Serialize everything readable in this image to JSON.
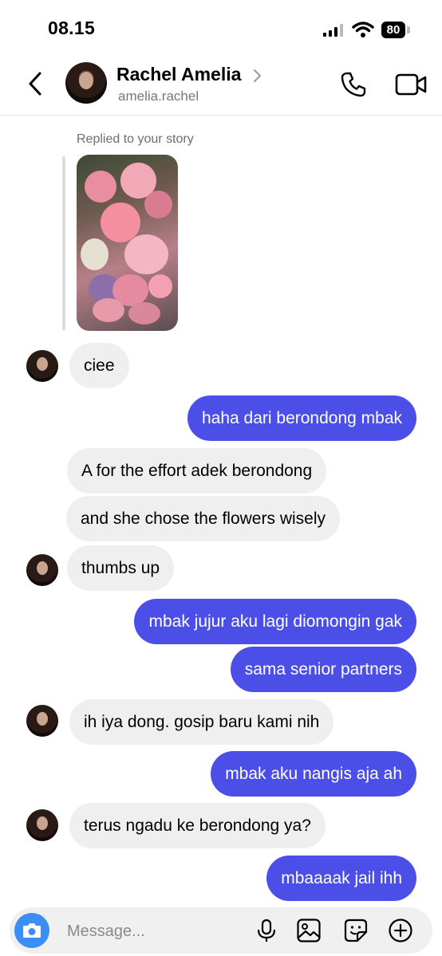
{
  "status_bar": {
    "time": "08.15",
    "battery": "80"
  },
  "header": {
    "name": "Rachel Amelia",
    "handle": "amelia.rachel"
  },
  "story_reply": {
    "label": "Replied to your story"
  },
  "messages": [
    {
      "side": "in",
      "text": "ciee"
    },
    {
      "side": "out",
      "text": "haha dari berondong mbak"
    },
    {
      "side": "in",
      "text": "A for the effort adek berondong"
    },
    {
      "side": "in",
      "text": "and she chose the flowers wisely"
    },
    {
      "side": "in",
      "text": "thumbs up"
    },
    {
      "side": "out",
      "text": "mbak jujur aku lagi diomongin gak"
    },
    {
      "side": "out",
      "text": "sama senior partners"
    },
    {
      "side": "in",
      "text": "ih iya dong. gosip baru kami nih"
    },
    {
      "side": "out",
      "text": "mbak aku nangis aja ah"
    },
    {
      "side": "in",
      "text": "terus ngadu ke berondong ya?"
    },
    {
      "side": "out",
      "text": "mbaaaak jail ihh"
    }
  ],
  "composer": {
    "placeholder": "Message..."
  },
  "colors": {
    "outgoing_bubble": "#4c4ee8",
    "incoming_bubble": "#efefef",
    "camera_button": "#3a8ef6"
  },
  "icons": [
    "back-arrow-icon",
    "chevron-right-icon",
    "phone-icon",
    "video-camera-icon",
    "camera-icon",
    "microphone-icon",
    "gallery-icon",
    "sticker-icon",
    "plus-circle-icon"
  ]
}
